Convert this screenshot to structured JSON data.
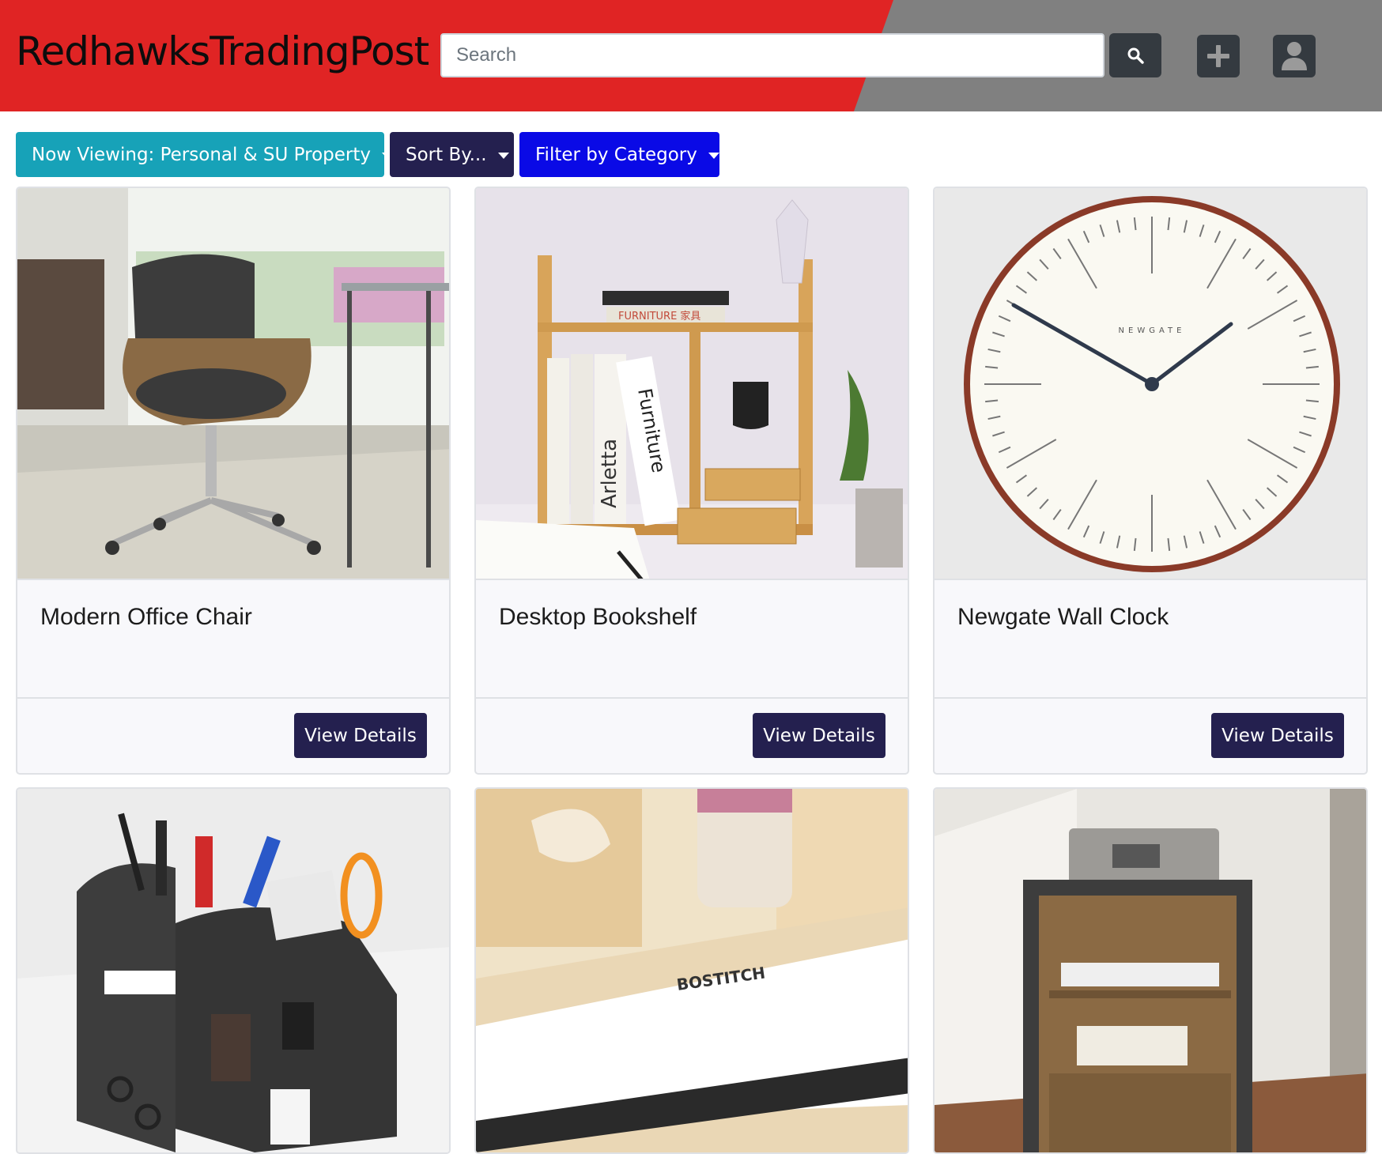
{
  "header": {
    "brand": "RedhawksTradingPost",
    "search": {
      "placeholder": "Search",
      "value": ""
    },
    "search_icon": "search-icon",
    "add_icon": "plus-icon",
    "profile_icon": "user-icon",
    "colors": {
      "red": "#e02424",
      "gray": "#808080",
      "button": "#343a40"
    }
  },
  "toolbar": {
    "viewing_label": "Now Viewing: Personal & SU Property",
    "sort_label": "Sort By...",
    "filter_label": "Filter by Category",
    "colors": {
      "viewing": "#17a2b8",
      "sort": "#24204f",
      "filter": "#0a0ae6"
    }
  },
  "cards": [
    {
      "title": "Modern Office Chair",
      "button": "View Details"
    },
    {
      "title": "Desktop Bookshelf",
      "button": "View Details"
    },
    {
      "title": "Newgate Wall Clock",
      "button": "View Details"
    },
    {
      "title": "",
      "button": ""
    },
    {
      "title": "",
      "button": ""
    },
    {
      "title": "",
      "button": ""
    }
  ],
  "images": {
    "clock_brand": "NEWGATE",
    "stapler_brand": "BOSTITCH",
    "book_spine_1": "Arletta",
    "book_spine_2": "Furniture",
    "book_top": "FURNITURE 家具"
  }
}
